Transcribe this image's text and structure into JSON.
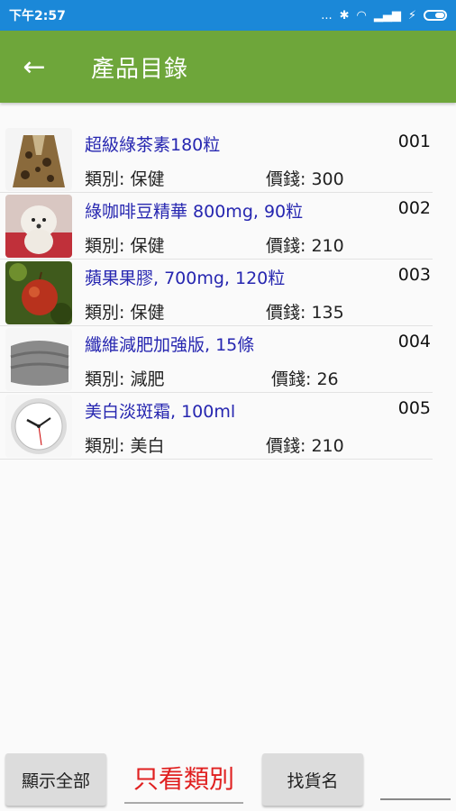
{
  "status": {
    "time": "下午2:57",
    "dots": "...",
    "bt": "✱",
    "wifi": "◠",
    "signal": "▂▄▆",
    "bolt": "⚡"
  },
  "appbar": {
    "back_icon": "←",
    "title": "產品目錄"
  },
  "products": [
    {
      "name": "超級綠茶素180粒",
      "code": "001",
      "category": "類別: 保健",
      "price": "價錢: 300",
      "thumb": "jacket-image"
    },
    {
      "name": "綠咖啡豆精華 800mg, 90粒",
      "code": "002",
      "category": "類別: 保健",
      "price": "價錢: 210",
      "thumb": "dog-image"
    },
    {
      "name": "蘋果果膠, 700mg, 120粒",
      "code": "003",
      "category": "類別: 保健",
      "price": "價錢: 135",
      "thumb": "apple-image"
    },
    {
      "name": "纖維減肥加強版, 15條",
      "code": "004",
      "category": "類別: 減肥",
      "price": "價錢: 26",
      "thumb": "towel-image"
    },
    {
      "name": "美白淡斑霜, 100ml",
      "code": "005",
      "category": "類別: 美白",
      "price": "價錢: 210",
      "thumb": "clock-image"
    }
  ],
  "bottom": {
    "show_all": "顯示全部",
    "by_category": "只看類別",
    "find_name": "找貨名"
  }
}
